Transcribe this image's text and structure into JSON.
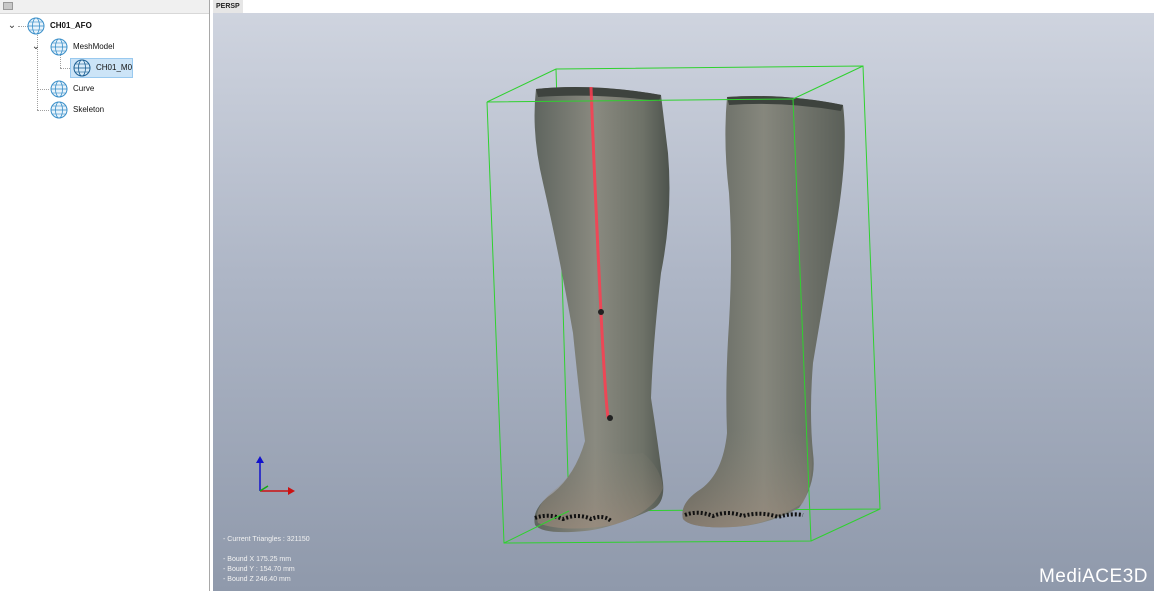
{
  "tree": {
    "items": [
      {
        "label": "CH01_AFO",
        "icon": "mesh-globe-icon"
      },
      {
        "label": "MeshModel",
        "icon": "mesh-globe-icon"
      },
      {
        "label": "CH01_M0",
        "icon": "mesh-globe-icon",
        "selected": true
      },
      {
        "label": "Curve",
        "icon": "mesh-globe-icon"
      },
      {
        "label": "Skeleton",
        "icon": "mesh-globe-icon"
      }
    ]
  },
  "viewport": {
    "tab_label": "PERSP",
    "current_triangles": "- Current Triangles : 321150",
    "bound_x": "- Bound X   175.25 mm",
    "bound_y": "- Bound Y : 154.70 mm",
    "bound_z": "- Bound Z   246.40 mm",
    "logo_text": "MediACE3D",
    "colors": {
      "bounding_box": "#2fd12f",
      "axis_x": "#cc1111",
      "axis_z": "#1111cc",
      "laser_line": "#ff3c50"
    }
  }
}
